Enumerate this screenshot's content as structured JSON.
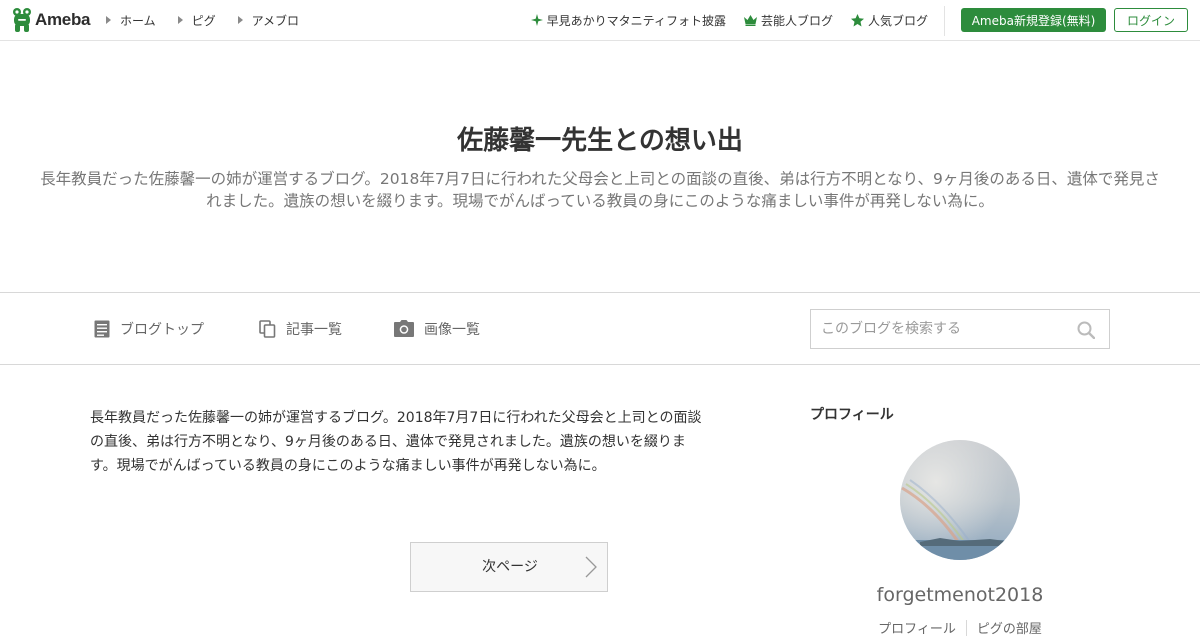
{
  "header": {
    "logo_text": "Ameba",
    "nav": [
      {
        "label": "ホーム"
      },
      {
        "label": "ピグ"
      },
      {
        "label": "アメブロ"
      }
    ],
    "promo_links": [
      {
        "label": "早見あかりマタニティフォト披露",
        "icon": "sparkle-icon"
      },
      {
        "label": "芸能人ブログ",
        "icon": "crown-icon"
      },
      {
        "label": "人気ブログ",
        "icon": "star-icon"
      }
    ],
    "register_label": "Ameba新規登録(無料)",
    "login_label": "ログイン",
    "accent_color": "#2d8c3c"
  },
  "blog": {
    "title": "佐藤馨一先生との想い出",
    "description": "長年教員だった佐藤馨一の姉が運営するブログ。2018年7月7日に行われた父母会と上司との面談の直後、弟は行方不明となり、9ヶ月後のある日、遺体で発見されました。遺族の想いを綴ります。現場でがんばっている教員の身にこのような痛ましい事件が再発しない為に。"
  },
  "blog_nav": {
    "items": [
      {
        "label": "ブログトップ",
        "icon": "document-icon"
      },
      {
        "label": "記事一覧",
        "icon": "copy-icon"
      },
      {
        "label": "画像一覧",
        "icon": "camera-icon"
      }
    ],
    "search_placeholder": "このブログを検索する"
  },
  "main": {
    "text": "長年教員だった佐藤馨一の姉が運営するブログ。2018年7月7日に行われた父母会と上司との面談の直後、弟は行方不明となり、9ヶ月後のある日、遺体で発見されました。遺族の想いを綴ります。現場でがんばっている教員の身にこのような痛ましい事件が再発しない為に。",
    "next_page_label": "次ページ"
  },
  "sidebar": {
    "heading": "プロフィール",
    "username": "forgetmenot2018",
    "links": [
      {
        "label": "プロフィール"
      },
      {
        "label": "ピグの部屋"
      }
    ]
  }
}
